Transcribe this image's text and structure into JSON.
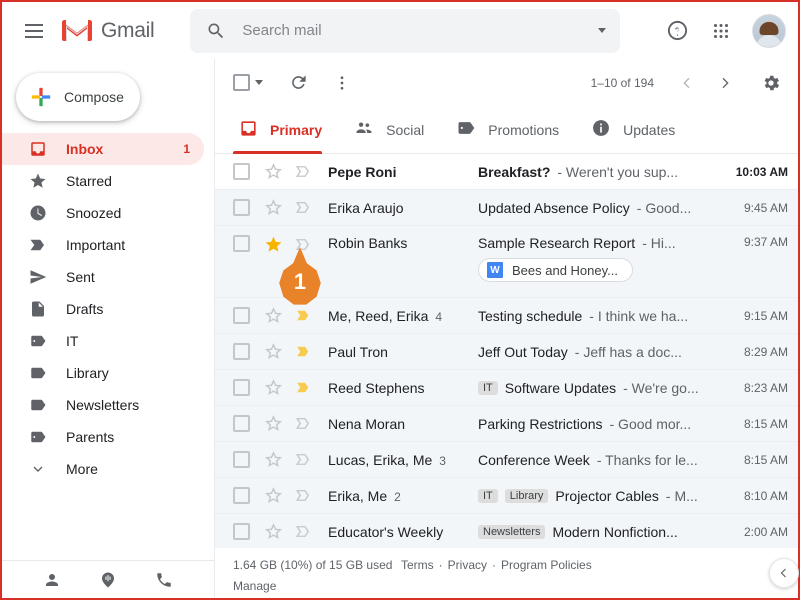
{
  "header": {
    "brand": "Gmail",
    "menu_icon": "hamburger-icon",
    "search": {
      "placeholder": "Search mail",
      "value": ""
    },
    "help_label": "?",
    "apps_label": "Google apps",
    "account_label": "Account"
  },
  "sidebar": {
    "compose": "Compose",
    "items": [
      {
        "icon": "inbox-icon",
        "label": "Inbox",
        "count": "1",
        "active": true
      },
      {
        "icon": "star-icon",
        "label": "Starred",
        "count": "",
        "active": false
      },
      {
        "icon": "clock-icon",
        "label": "Snoozed",
        "count": "",
        "active": false
      },
      {
        "icon": "important-icon",
        "label": "Important",
        "count": "",
        "active": false
      },
      {
        "icon": "send-icon",
        "label": "Sent",
        "count": "",
        "active": false
      },
      {
        "icon": "draft-icon",
        "label": "Drafts",
        "count": "",
        "active": false
      },
      {
        "icon": "label-icon",
        "label": "IT",
        "count": "",
        "active": false
      },
      {
        "icon": "label-icon",
        "label": "Library",
        "count": "",
        "active": false
      },
      {
        "icon": "label-icon",
        "label": "Newsletters",
        "count": "",
        "active": false
      },
      {
        "icon": "label-icon",
        "label": "Parents",
        "count": "",
        "active": false
      },
      {
        "icon": "chevron-down-icon",
        "label": "More",
        "count": "",
        "active": false
      }
    ],
    "bottom_icons": [
      "contacts-icon",
      "chat-icon",
      "phone-icon"
    ]
  },
  "toolbar": {
    "select_all_label": "Select",
    "refresh_label": "Refresh",
    "more_label": "More",
    "page_range": "1–10 of 194",
    "prev_label": "Newer",
    "next_label": "Older",
    "settings_label": "Settings"
  },
  "tabs": [
    {
      "icon": "inbox-icon",
      "label": "Primary",
      "active": true
    },
    {
      "icon": "people-icon",
      "label": "Social",
      "active": false
    },
    {
      "icon": "tag-icon",
      "label": "Promotions",
      "active": false
    },
    {
      "icon": "info-icon",
      "label": "Updates",
      "active": false
    }
  ],
  "emails": [
    {
      "sender": "Pepe Roni",
      "count": "",
      "subject": "Breakfast?",
      "snippet": "- Weren't you sup...",
      "time": "10:03 AM",
      "unread": true,
      "starred": false,
      "important": false,
      "labels": [],
      "attachment": null
    },
    {
      "sender": "Erika Araujo",
      "count": "",
      "subject": "Updated Absence Policy",
      "snippet": "- Good...",
      "time": "9:45 AM",
      "unread": false,
      "starred": false,
      "important": false,
      "labels": [],
      "attachment": null
    },
    {
      "sender": "Robin Banks",
      "count": "",
      "subject": "Sample Research Report",
      "snippet": "- Hi...",
      "time": "9:37 AM",
      "unread": false,
      "starred": true,
      "important": false,
      "labels": [],
      "attachment": {
        "icon_letter": "W",
        "name": "Bees and Honey..."
      }
    },
    {
      "sender": "Me, Reed, Erika",
      "count": "4",
      "subject": "Testing schedule",
      "snippet": "- I think we ha...",
      "time": "9:15 AM",
      "unread": false,
      "starred": false,
      "important": true,
      "labels": [],
      "attachment": null
    },
    {
      "sender": "Paul Tron",
      "count": "",
      "subject": "Jeff Out Today",
      "snippet": "- Jeff has a doc...",
      "time": "8:29 AM",
      "unread": false,
      "starred": false,
      "important": true,
      "labels": [],
      "attachment": null
    },
    {
      "sender": "Reed Stephens",
      "count": "",
      "subject": "Software Updates",
      "snippet": "- We're go...",
      "time": "8:23 AM",
      "unread": false,
      "starred": false,
      "important": true,
      "labels": [
        "IT"
      ],
      "attachment": null
    },
    {
      "sender": "Nena Moran",
      "count": "",
      "subject": "Parking Restrictions",
      "snippet": "- Good mor...",
      "time": "8:15 AM",
      "unread": false,
      "starred": false,
      "important": false,
      "labels": [],
      "attachment": null
    },
    {
      "sender": "Lucas, Erika, Me",
      "count": "3",
      "subject": "Conference Week",
      "snippet": "- Thanks for le...",
      "time": "8:15 AM",
      "unread": false,
      "starred": false,
      "important": false,
      "labels": [],
      "attachment": null
    },
    {
      "sender": "Erika, Me",
      "count": "2",
      "subject": "Projector Cables",
      "snippet": "- M...",
      "time": "8:10 AM",
      "unread": false,
      "starred": false,
      "important": false,
      "labels": [
        "IT",
        "Library"
      ],
      "attachment": null
    },
    {
      "sender": "Educator's Weekly",
      "count": "",
      "subject": "Modern Nonfiction...",
      "snippet": "",
      "time": "2:00 AM",
      "unread": false,
      "starred": false,
      "important": false,
      "labels": [
        "Newsletters"
      ],
      "attachment": null
    }
  ],
  "footer": {
    "storage": "1.64 GB (10%) of 15 GB used",
    "manage": "Manage",
    "terms": "Terms",
    "privacy": "Privacy",
    "policies": "Program Policies",
    "sep": "·"
  },
  "marker": {
    "number": "1"
  },
  "collapse": {
    "icon": "chevron-left-icon"
  },
  "colors": {
    "accent": "#d93025",
    "active_bg": "#fce8e6",
    "read_row_bg": "#f2f6f8",
    "star_yellow": "#f4b400",
    "important_yellow": "#f7cb4d",
    "marker_orange": "#e8832a",
    "attach_blue": "#4285f4"
  }
}
